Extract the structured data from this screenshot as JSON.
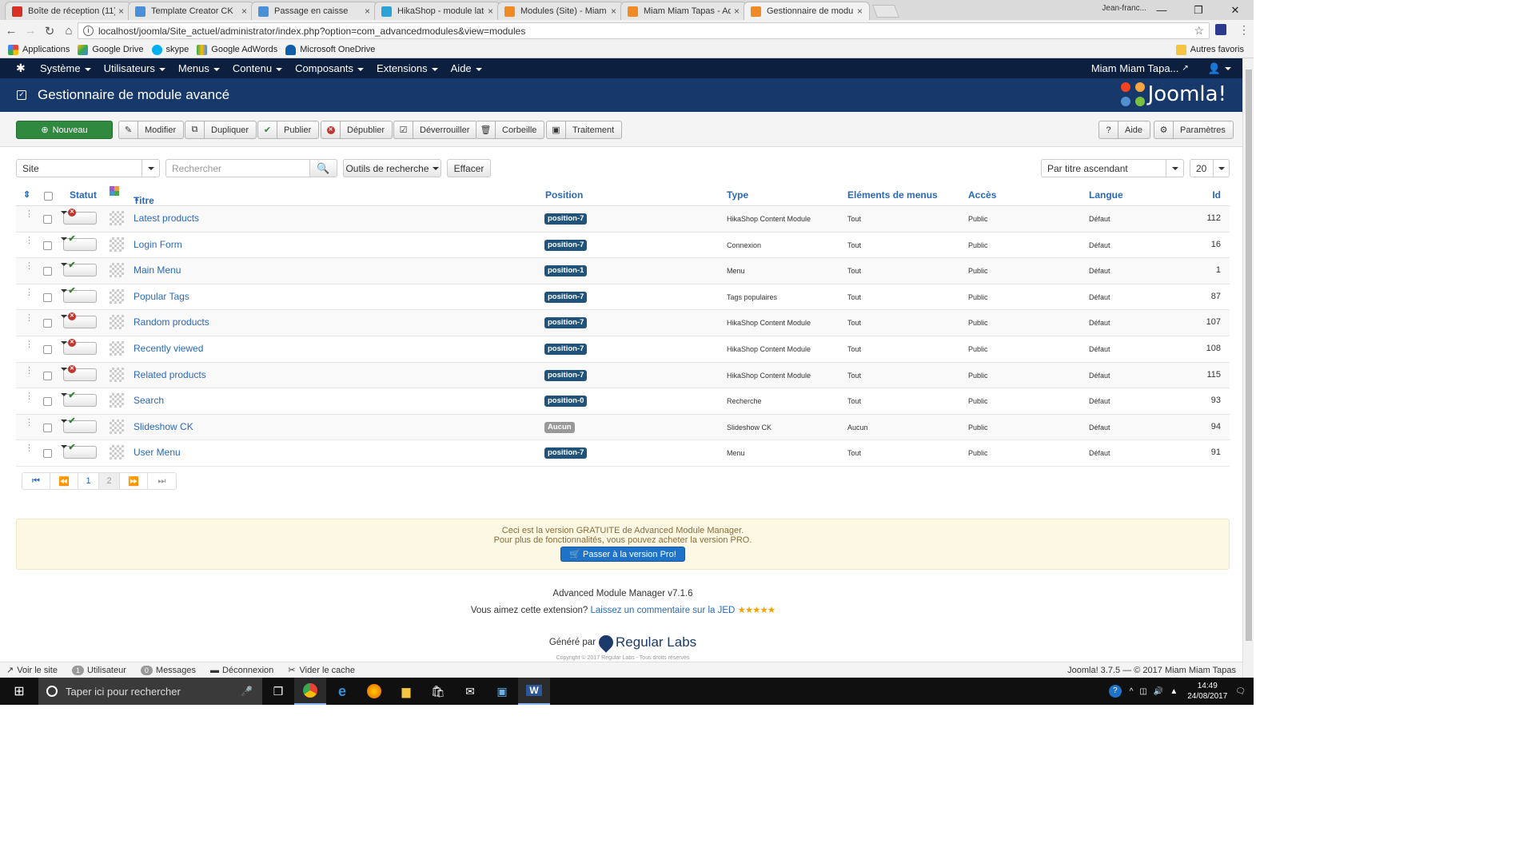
{
  "browser": {
    "tabs": [
      {
        "label": "Boîte de réception (11) -",
        "icon": "gmail-icon",
        "color": "#d93025"
      },
      {
        "label": "Template Creator CK",
        "icon": "joomla-icon",
        "color": "#4a90d9"
      },
      {
        "label": "Passage en caisse",
        "icon": "joomla-icon",
        "color": "#4a90d9"
      },
      {
        "label": "HikaShop - module lates",
        "icon": "hikashop-icon",
        "color": "#29a3d6"
      },
      {
        "label": "Modules (Site) - Miam M",
        "icon": "joomla-icon",
        "color": "#f08a24"
      },
      {
        "label": "Miam Miam Tapas - Adm",
        "icon": "joomla-icon",
        "color": "#f08a24"
      },
      {
        "label": "Gestionnaire de module",
        "icon": "joomla-icon",
        "color": "#f08a24"
      }
    ],
    "profile": "Jean-franc...",
    "url": "localhost/joomla/Site_actuel/administrator/index.php?option=com_advancedmodules&view=modules",
    "bookmarks": [
      "Applications",
      "Google Drive",
      "skype",
      "Google AdWords",
      "Microsoft OneDrive"
    ],
    "other_bookmarks": "Autres favoris"
  },
  "joomla": {
    "menu": [
      "Système",
      "Utilisateurs",
      "Menus",
      "Contenu",
      "Composants",
      "Extensions",
      "Aide"
    ],
    "site_name": "Miam Miam Tapa...",
    "page_title": "Gestionnaire de module avancé",
    "logo_text": "Joomla!",
    "toolbar": {
      "new": "Nouveau",
      "edit": "Modifier",
      "duplicate": "Dupliquer",
      "publish": "Publier",
      "unpublish": "Dépublier",
      "unlock": "Déverrouiller",
      "trash": "Corbeille",
      "batch": "Traitement",
      "help": "Aide",
      "options": "Paramètres"
    },
    "filters": {
      "client": "Site",
      "search_placeholder": "Rechercher",
      "search_tools": "Outils de recherche",
      "clear": "Effacer",
      "ordering": "Par titre ascendant",
      "limit": "20"
    },
    "columns": {
      "status": "Statut",
      "title": "Titre",
      "position": "Position",
      "type": "Type",
      "menu_items": "Eléments de menus",
      "access": "Accès",
      "language": "Langue",
      "id": "Id"
    },
    "rows": [
      {
        "title": "Latest products",
        "published": false,
        "position": "position-7",
        "type": "HikaShop Content Module",
        "menu": "Tout",
        "access": "Public",
        "lang": "Défaut",
        "id": "112"
      },
      {
        "title": "Login Form",
        "published": true,
        "position": "position-7",
        "type": "Connexion",
        "menu": "Tout",
        "access": "Public",
        "lang": "Défaut",
        "id": "16"
      },
      {
        "title": "Main Menu",
        "published": true,
        "position": "position-1",
        "type": "Menu",
        "menu": "Tout",
        "access": "Public",
        "lang": "Défaut",
        "id": "1"
      },
      {
        "title": "Popular Tags",
        "published": true,
        "position": "position-7",
        "type": "Tags populaires",
        "menu": "Tout",
        "access": "Public",
        "lang": "Défaut",
        "id": "87"
      },
      {
        "title": "Random products",
        "published": false,
        "position": "position-7",
        "type": "HikaShop Content Module",
        "menu": "Tout",
        "access": "Public",
        "lang": "Défaut",
        "id": "107"
      },
      {
        "title": "Recently viewed",
        "published": false,
        "position": "position-7",
        "type": "HikaShop Content Module",
        "menu": "Tout",
        "access": "Public",
        "lang": "Défaut",
        "id": "108"
      },
      {
        "title": "Related products",
        "published": false,
        "position": "position-7",
        "type": "HikaShop Content Module",
        "menu": "Tout",
        "access": "Public",
        "lang": "Défaut",
        "id": "115"
      },
      {
        "title": "Search",
        "published": true,
        "position": "position-0",
        "type": "Recherche",
        "menu": "Tout",
        "access": "Public",
        "lang": "Défaut",
        "id": "93"
      },
      {
        "title": "Slideshow CK",
        "published": true,
        "position": "Aucun",
        "type": "Slideshow CK",
        "menu": "Aucun",
        "access": "Public",
        "lang": "Défaut",
        "id": "94"
      },
      {
        "title": "User Menu",
        "published": true,
        "position": "position-7",
        "type": "Menu",
        "menu": "Tout",
        "access": "Public",
        "lang": "Défaut",
        "id": "91"
      }
    ],
    "pagination": {
      "pages": [
        "1",
        "2"
      ],
      "current": "2"
    },
    "notice": {
      "line1": "Ceci est la version GRATUITE de Advanced Module Manager.",
      "line2": "Pour plus de fonctionnalités, vous pouvez acheter la version PRO.",
      "button": "Passer à la version Pro!"
    },
    "footer": {
      "version": "Advanced Module Manager v7.1.6",
      "like": "Vous aimez cette extension?",
      "review_link": "Laissez un commentaire sur la JED",
      "stars": "★★★★★",
      "generated_by": "Généré par",
      "brand": "Regular Labs",
      "copyright": "Copyright © 2017 Regular Labs - Tous droits réservés"
    },
    "statusbar": {
      "view_site": "Voir le site",
      "users_count": "1",
      "users": "Utilisateur",
      "messages_count": "0",
      "messages": "Messages",
      "logout": "Déconnexion",
      "clear_cache": "Vider le cache",
      "version": "Joomla! 3.7.5 — © 2017 Miam Miam Tapas"
    }
  },
  "taskbar": {
    "search": "Taper ici pour rechercher",
    "time": "14:49",
    "date": "24/08/2017"
  }
}
